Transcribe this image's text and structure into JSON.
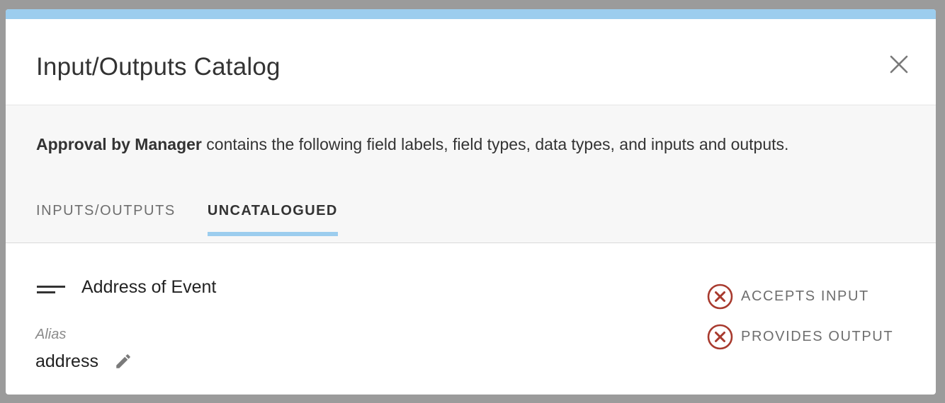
{
  "modal": {
    "title": "Input/Outputs Catalog",
    "close_icon": "close-icon",
    "accent_color": "#9ccdee"
  },
  "description": {
    "process_name": "Approval by Manager",
    "text": " contains the following field labels, field types, data types, and inputs and outputs."
  },
  "tabs": [
    {
      "label": "INPUTS/OUTPUTS",
      "active": false
    },
    {
      "label": "UNCATALOGUED",
      "active": true
    }
  ],
  "field": {
    "icon": "short-text-icon",
    "name": "Address of Event",
    "alias_label": "Alias",
    "alias_value": "address",
    "edit_icon": "pencil-icon"
  },
  "capabilities": [
    {
      "label": "ACCEPTS INPUT",
      "icon": "x-circle-icon",
      "color": "#a83a2e"
    },
    {
      "label": "PROVIDES OUTPUT",
      "icon": "x-circle-icon",
      "color": "#a83a2e"
    }
  ]
}
